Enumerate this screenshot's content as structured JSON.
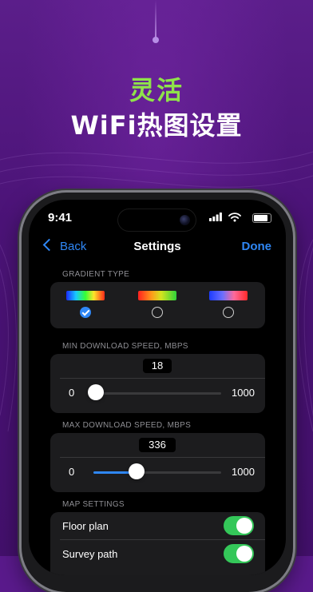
{
  "promo": {
    "headline_accent": "灵活",
    "headline_main": "WiFi热图设置",
    "accent_color": "#8fe34a"
  },
  "status_bar": {
    "time": "9:41",
    "icons": [
      "cellular-signal-icon",
      "wifi-icon",
      "battery-icon"
    ]
  },
  "nav": {
    "back_label": "Back",
    "title": "Settings",
    "done_label": "Done",
    "link_color": "#2f87f5"
  },
  "gradient_type": {
    "header": "GRADIENT TYPE",
    "options": [
      {
        "name": "rainbow",
        "selected": true
      },
      {
        "name": "red-to-green",
        "selected": false
      },
      {
        "name": "blue-to-red",
        "selected": false
      }
    ]
  },
  "min_speed": {
    "header": "MIN DOWNLOAD SPEED, MBPS",
    "value": "18",
    "min": "0",
    "max": "1000",
    "slider_value": 18
  },
  "max_speed": {
    "header": "MAX DOWNLOAD SPEED, MBPS",
    "value": "336",
    "min": "0",
    "max": "1000",
    "slider_value": 336
  },
  "map_settings": {
    "header": "MAP SETTINGS",
    "rows": [
      {
        "label": "Floor plan",
        "on": true
      },
      {
        "label": "Survey path",
        "on": true
      }
    ]
  },
  "colors": {
    "background": "#4b1377",
    "toggle_on": "#34c759",
    "card": "#1c1c1e"
  }
}
